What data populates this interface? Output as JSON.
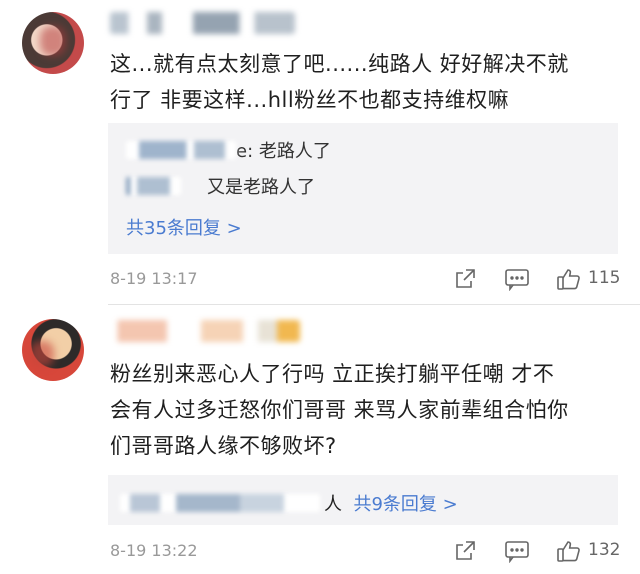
{
  "comments": [
    {
      "text_line1": "这...就有点太刻意了吧......纯路人 好好解决不就",
      "text_line2": "行了 非要这样...hll粉丝不也都支持维权嘛",
      "replies": [
        {
          "text": "e: 老路人了"
        },
        {
          "text": "又是老路人了"
        }
      ],
      "more_replies": "共35条回复 >",
      "time": "8-19 13:17",
      "likes": "115"
    },
    {
      "text_line1": "粉丝别来恶心人了行吗 立正挨打躺平任嘲 才不",
      "text_line2": "会有人过多迁怒你们哥哥 来骂人家前辈组合怕你",
      "text_line3": "们哥哥路人缘不够败坏?",
      "reply_suffix": "人",
      "more_replies": "共9条回复 >",
      "time": "8-19 13:22",
      "likes": "132"
    }
  ],
  "icons": {
    "share": "share-icon",
    "comment": "comment-icon",
    "like": "thumbs-up-icon"
  },
  "colors": {
    "link": "#4a7bd0",
    "meta": "#999999",
    "reply_bg": "#f3f3f5"
  }
}
